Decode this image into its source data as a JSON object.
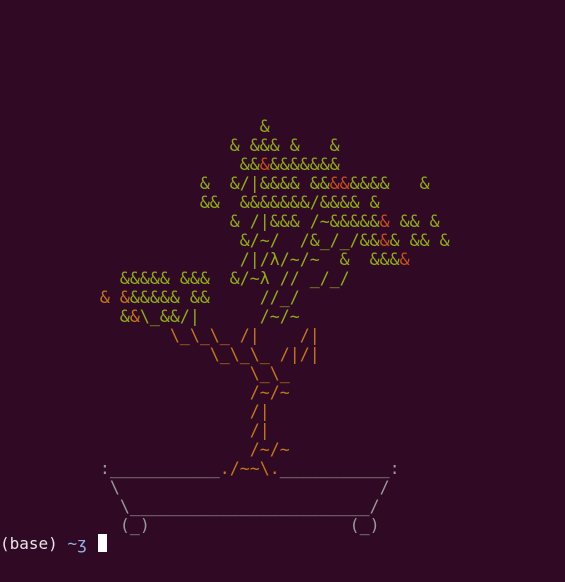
{
  "bonsai_lines": [
    [
      {
        "t": "                          ",
        "c": "green"
      },
      {
        "t": "&",
        "c": "green"
      }
    ],
    [
      {
        "t": "                       ",
        "c": "green"
      },
      {
        "t": "& &&& &   &",
        "c": "green"
      }
    ],
    [
      {
        "t": "                        ",
        "c": "green"
      },
      {
        "t": "&&",
        "c": "green"
      },
      {
        "t": "&",
        "c": "red"
      },
      {
        "t": "&&&&&&&",
        "c": "green"
      }
    ],
    [
      {
        "t": "                    ",
        "c": "green"
      },
      {
        "t": "&  &/|&&&& &&",
        "c": "green"
      },
      {
        "t": "&&",
        "c": "red"
      },
      {
        "t": "&&&&   &",
        "c": "green"
      }
    ],
    [
      {
        "t": "                    ",
        "c": "green"
      },
      {
        "t": "&&  &&&&&&&/&&&& &",
        "c": "green"
      }
    ],
    [
      {
        "t": "                       ",
        "c": "green"
      },
      {
        "t": "& /|&&& /~&&&&&",
        "c": "green"
      },
      {
        "t": "&",
        "c": "red"
      },
      {
        "t": " && &",
        "c": "green"
      }
    ],
    [
      {
        "t": "                        ",
        "c": "green"
      },
      {
        "t": "&/~/  /&_/_/&&",
        "c": "green"
      },
      {
        "t": "&",
        "c": "red"
      },
      {
        "t": "& && &",
        "c": "green"
      }
    ],
    [
      {
        "t": "                        ",
        "c": "green"
      },
      {
        "t": "/|/λ/~/~  &  &&&",
        "c": "green"
      },
      {
        "t": "&",
        "c": "red"
      }
    ],
    [
      {
        "t": "            ",
        "c": "green"
      },
      {
        "t": "&&&&& &&&  &/~λ // _/_/",
        "c": "green"
      }
    ],
    [
      {
        "t": "          ",
        "c": "green"
      },
      {
        "t": "&",
        "c": "orange"
      },
      {
        "t": " ",
        "c": "green"
      },
      {
        "t": "&",
        "c": "orange"
      },
      {
        "t": "&&&&& &&     //_/",
        "c": "green"
      }
    ],
    [
      {
        "t": "            ",
        "c": "green"
      },
      {
        "t": "&",
        "c": "green"
      },
      {
        "t": "&",
        "c": "orange"
      },
      {
        "t": "\\_&&/|      /~/~",
        "c": "green"
      }
    ],
    [
      {
        "t": "                 ",
        "c": "wood"
      },
      {
        "t": "\\_\\_\\_ /|    /|",
        "c": "wood"
      }
    ],
    [
      {
        "t": "                     ",
        "c": "wood"
      },
      {
        "t": "\\_\\_\\_ /|/|",
        "c": "wood"
      }
    ],
    [
      {
        "t": "                         ",
        "c": "wood"
      },
      {
        "t": "\\_\\_",
        "c": "wood"
      }
    ],
    [
      {
        "t": "                         ",
        "c": "wood"
      },
      {
        "t": "/~/~",
        "c": "wood"
      }
    ],
    [
      {
        "t": "                         ",
        "c": "wood"
      },
      {
        "t": "/|",
        "c": "wood"
      }
    ],
    [
      {
        "t": "                         ",
        "c": "wood"
      },
      {
        "t": "/|",
        "c": "wood"
      }
    ],
    [
      {
        "t": "                         ",
        "c": "wood"
      },
      {
        "t": "/~/~",
        "c": "wood"
      }
    ],
    [
      {
        "t": "          :___________",
        "c": "base"
      },
      {
        "t": "./~~\\.",
        "c": "wood"
      },
      {
        "t": "___________:",
        "c": "base"
      }
    ],
    [
      {
        "t": "           \\                          /",
        "c": "base"
      }
    ],
    [
      {
        "t": "            \\________________________/",
        "c": "base"
      }
    ],
    [
      {
        "t": "            (_)                    (_)",
        "c": "base"
      }
    ]
  ],
  "prompt": {
    "env": "(base) ",
    "path": "~ʒ",
    "trailing": " "
  }
}
